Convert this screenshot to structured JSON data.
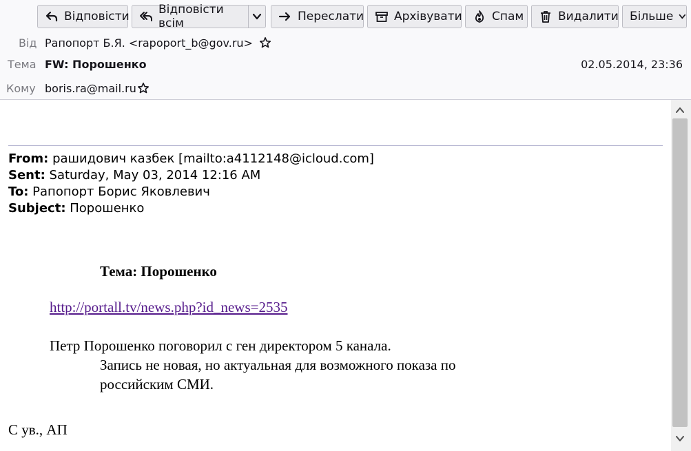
{
  "toolbar": {
    "reply": "Відповісти",
    "reply_all": "Відповісти всім",
    "forward": "Переслати",
    "archive": "Архівувати",
    "spam": "Спам",
    "delete": "Видалити",
    "more": "Більше"
  },
  "header": {
    "from_label": "Від",
    "from_value": "Рапопорт Б.Я. <rapoport_b@gov.ru>",
    "subject_label": "Тема",
    "subject_value": "FW: Порошенко",
    "to_label": "Кому",
    "to_value": "boris.ra@mail.ru",
    "date": "02.05.2014, 23:36"
  },
  "message": {
    "from_key": "From:",
    "from_value": " рашидович казбек [mailto:a4112148@icloud.com]",
    "sent_key": "Sent:",
    "sent_value": " Saturday, May 03, 2014 12:16 AM",
    "to_key": "To:",
    "to_value": " Рапопорт Борис Яковлевич",
    "subject_key": "Subject:",
    "subject_value": " Порошенко",
    "heading": "Тема: Порошенко",
    "link": "http://portall.tv/news.php?id_news=2535",
    "para_line1": "Петр Порошенко поговорил с ген директором 5 канала.",
    "para_line2": "Запись не новая, но актуальная для возможного показа по",
    "para_line3": "российским СМИ.",
    "signature": "С ув., АП"
  },
  "icons": [
    "reply-icon",
    "reply-all-icon",
    "forward-icon",
    "archive-icon",
    "spam-icon",
    "delete-icon",
    "chevron-down-icon",
    "star-icon",
    "scroll-up-icon",
    "scroll-down-icon"
  ]
}
